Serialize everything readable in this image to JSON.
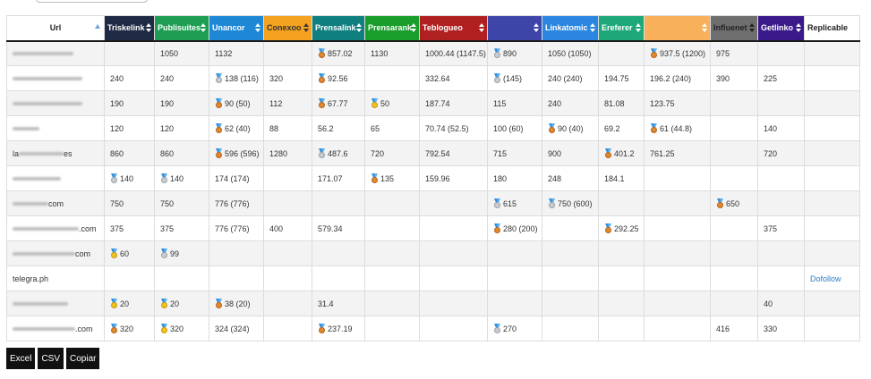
{
  "columns": [
    {
      "label": "Url",
      "bg": "#ffffff",
      "fg": "#222222"
    },
    {
      "label": "Triskelink",
      "bg": "#1f2a44",
      "fg": "#ffffff"
    },
    {
      "label": "Publisuites",
      "bg": "#1e9e53",
      "fg": "#ffffff"
    },
    {
      "label": "Unancor",
      "bg": "#1e88d6",
      "fg": "#ffffff"
    },
    {
      "label": "Conexoo",
      "bg": "#f4a21f",
      "fg": "#333333"
    },
    {
      "label": "Prensalink",
      "bg": "#0f7f7f",
      "fg": "#ffffff"
    },
    {
      "label": "Prensarank",
      "bg": "#1a9e2b",
      "fg": "#ffffff"
    },
    {
      "label": "Teblogueo",
      "bg": "#b02020",
      "fg": "#ffffff"
    },
    {
      "label": "",
      "bg": "#3d45a8",
      "fg": "#ffffff"
    },
    {
      "label": "Linkatomic",
      "bg": "#2a86e0",
      "fg": "#ffffff"
    },
    {
      "label": "Ereferer",
      "bg": "#1ea87a",
      "fg": "#ffffff"
    },
    {
      "label": "",
      "bg": "#f8b15a",
      "fg": "#ffffff"
    },
    {
      "label": "Influenet",
      "bg": "#6e6e6e",
      "fg": "#222222"
    },
    {
      "label": "Getlinko",
      "bg": "#3a1a8a",
      "fg": "#ffffff"
    },
    {
      "label": "Replicable",
      "bg": "#ffffff",
      "fg": "#222222"
    }
  ],
  "rows": [
    {
      "url": "",
      "blur": 68,
      "cells": [
        {
          "v": ""
        },
        {
          "v": "1050"
        },
        {
          "v": "1132"
        },
        {
          "v": ""
        },
        {
          "v": "857.02",
          "m": "bronze"
        },
        {
          "v": "1130"
        },
        {
          "v": "1000.44 (1147.5)"
        },
        {
          "v": "890",
          "m": "silver"
        },
        {
          "v": "1050 (1050)"
        },
        {
          "v": ""
        },
        {
          "v": "937.5 (1200)",
          "m": "bronze"
        },
        {
          "v": "975"
        },
        {
          "v": ""
        },
        {
          "v": ""
        }
      ]
    },
    {
      "url": "",
      "blur": 78,
      "cells": [
        {
          "v": "240"
        },
        {
          "v": "240"
        },
        {
          "v": "138 (116)",
          "m": "silver"
        },
        {
          "v": "320"
        },
        {
          "v": "92.56",
          "m": "bronze"
        },
        {
          "v": ""
        },
        {
          "v": "332.64"
        },
        {
          "v": "(145)",
          "m": "silver"
        },
        {
          "v": "240 (240)"
        },
        {
          "v": "194.75"
        },
        {
          "v": "196.2 (240)"
        },
        {
          "v": "390"
        },
        {
          "v": "225"
        },
        {
          "v": ""
        }
      ]
    },
    {
      "url": "",
      "blur": 78,
      "cells": [
        {
          "v": "190"
        },
        {
          "v": "190"
        },
        {
          "v": "90 (50)",
          "m": "bronze"
        },
        {
          "v": "112"
        },
        {
          "v": "67.77",
          "m": "bronze"
        },
        {
          "v": "50",
          "m": "gold"
        },
        {
          "v": "187.74"
        },
        {
          "v": "115"
        },
        {
          "v": "240"
        },
        {
          "v": "81.08"
        },
        {
          "v": "123.75"
        },
        {
          "v": ""
        },
        {
          "v": ""
        },
        {
          "v": ""
        }
      ]
    },
    {
      "url": "",
      "blur": 30,
      "cells": [
        {
          "v": "120"
        },
        {
          "v": "120"
        },
        {
          "v": "62 (40)",
          "m": "bronze"
        },
        {
          "v": "88"
        },
        {
          "v": "56.2"
        },
        {
          "v": "65"
        },
        {
          "v": "70.74 (52.5)"
        },
        {
          "v": "100 (60)"
        },
        {
          "v": "90 (40)",
          "m": "bronze"
        },
        {
          "v": "69.2"
        },
        {
          "v": "61 (44.8)",
          "m": "bronze"
        },
        {
          "v": ""
        },
        {
          "v": "140"
        },
        {
          "v": ""
        }
      ]
    },
    {
      "url": "la",
      "suffix": "es",
      "blur": 50,
      "cells": [
        {
          "v": "860"
        },
        {
          "v": "860"
        },
        {
          "v": "596 (596)",
          "m": "bronze"
        },
        {
          "v": "1280"
        },
        {
          "v": "487.6",
          "m": "silver"
        },
        {
          "v": "720"
        },
        {
          "v": "792.54"
        },
        {
          "v": "715"
        },
        {
          "v": "900"
        },
        {
          "v": "401.2",
          "m": "bronze"
        },
        {
          "v": "761.25"
        },
        {
          "v": ""
        },
        {
          "v": "720"
        },
        {
          "v": ""
        }
      ]
    },
    {
      "url": "",
      "blur": 54,
      "cells": [
        {
          "v": "140",
          "m": "silver"
        },
        {
          "v": "140",
          "m": "silver"
        },
        {
          "v": "174 (174)"
        },
        {
          "v": ""
        },
        {
          "v": "171.07"
        },
        {
          "v": "135",
          "m": "bronze"
        },
        {
          "v": "159.96"
        },
        {
          "v": "180"
        },
        {
          "v": "248"
        },
        {
          "v": "184.1"
        },
        {
          "v": ""
        },
        {
          "v": ""
        },
        {
          "v": ""
        },
        {
          "v": ""
        }
      ]
    },
    {
      "url": "",
      "suffix": "com",
      "blur": 40,
      "cells": [
        {
          "v": "750"
        },
        {
          "v": "750"
        },
        {
          "v": "776 (776)"
        },
        {
          "v": ""
        },
        {
          "v": ""
        },
        {
          "v": ""
        },
        {
          "v": ""
        },
        {
          "v": "615",
          "m": "silver"
        },
        {
          "v": "750 (600)",
          "m": "silver"
        },
        {
          "v": ""
        },
        {
          "v": ""
        },
        {
          "v": "650",
          "m": "bronze"
        },
        {
          "v": ""
        },
        {
          "v": ""
        }
      ]
    },
    {
      "url": "",
      "suffix": ".com",
      "blur": 74,
      "cells": [
        {
          "v": "375"
        },
        {
          "v": "375"
        },
        {
          "v": "776 (776)"
        },
        {
          "v": "400"
        },
        {
          "v": "579.34"
        },
        {
          "v": ""
        },
        {
          "v": ""
        },
        {
          "v": "280 (200)",
          "m": "bronze"
        },
        {
          "v": ""
        },
        {
          "v": "292.25",
          "m": "bronze"
        },
        {
          "v": ""
        },
        {
          "v": ""
        },
        {
          "v": "375"
        },
        {
          "v": ""
        }
      ]
    },
    {
      "url": "",
      "suffix": "com",
      "blur": 70,
      "cells": [
        {
          "v": "60",
          "m": "gold"
        },
        {
          "v": "99",
          "m": "silver"
        },
        {
          "v": ""
        },
        {
          "v": ""
        },
        {
          "v": ""
        },
        {
          "v": ""
        },
        {
          "v": ""
        },
        {
          "v": ""
        },
        {
          "v": ""
        },
        {
          "v": ""
        },
        {
          "v": ""
        },
        {
          "v": ""
        },
        {
          "v": ""
        },
        {
          "v": ""
        }
      ]
    },
    {
      "url": "telegra.ph",
      "blur": 0,
      "cells": [
        {
          "v": ""
        },
        {
          "v": ""
        },
        {
          "v": ""
        },
        {
          "v": ""
        },
        {
          "v": ""
        },
        {
          "v": ""
        },
        {
          "v": ""
        },
        {
          "v": ""
        },
        {
          "v": ""
        },
        {
          "v": ""
        },
        {
          "v": ""
        },
        {
          "v": ""
        },
        {
          "v": ""
        },
        {
          "v": "Dofollow",
          "link": true
        }
      ]
    },
    {
      "url": "",
      "blur": 62,
      "cells": [
        {
          "v": "20",
          "m": "gold"
        },
        {
          "v": "20",
          "m": "gold"
        },
        {
          "v": "38 (20)",
          "m": "bronze"
        },
        {
          "v": ""
        },
        {
          "v": "31.4"
        },
        {
          "v": ""
        },
        {
          "v": ""
        },
        {
          "v": ""
        },
        {
          "v": ""
        },
        {
          "v": ""
        },
        {
          "v": ""
        },
        {
          "v": ""
        },
        {
          "v": "40"
        },
        {
          "v": ""
        }
      ]
    },
    {
      "url": "",
      "suffix": ".com",
      "blur": 70,
      "cells": [
        {
          "v": "320",
          "m": "bronze"
        },
        {
          "v": "320",
          "m": "gold"
        },
        {
          "v": "324 (324)"
        },
        {
          "v": ""
        },
        {
          "v": "237.19",
          "m": "bronze"
        },
        {
          "v": ""
        },
        {
          "v": ""
        },
        {
          "v": "270",
          "m": "silver"
        },
        {
          "v": ""
        },
        {
          "v": ""
        },
        {
          "v": ""
        },
        {
          "v": "416"
        },
        {
          "v": "330"
        },
        {
          "v": ""
        }
      ]
    }
  ],
  "buttons": {
    "excel": "Excel",
    "csv": "CSV",
    "copy": "Copiar"
  }
}
